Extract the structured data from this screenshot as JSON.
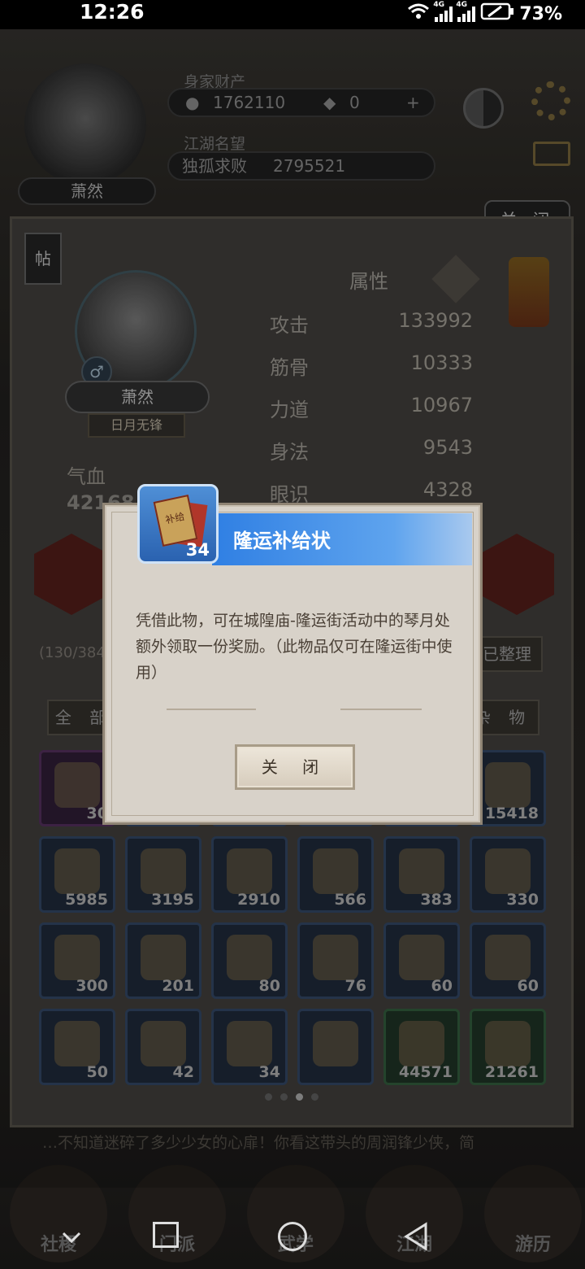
{
  "status": {
    "time": "12:26",
    "battery": "73%",
    "net1": "4G",
    "net2": "4G"
  },
  "header": {
    "wealth_label": "身家财产",
    "coins": "1762110",
    "gems": "0",
    "add": "+",
    "fame_label": "江湖名望",
    "fame_title": "独孤求败",
    "fame_value": "2795521",
    "player_name": "萧然"
  },
  "panel": {
    "close_label": "关 闭",
    "post_label": "帖",
    "attr_title": "属性",
    "char_name": "萧然",
    "char_title": "日月无锋",
    "attributes": [
      {
        "name": "攻击",
        "value": "133992"
      },
      {
        "name": "筋骨",
        "value": "10333"
      },
      {
        "name": "力道",
        "value": "10967"
      },
      {
        "name": "身法",
        "value": "9543"
      },
      {
        "name": "眼识",
        "value": "4328"
      }
    ],
    "qixue_label": "气血",
    "qixue_value": "42168",
    "capacity": "(130/384",
    "sort_label": "已整理",
    "tab_all": "全 部",
    "tab_misc": "杂 物"
  },
  "items": [
    {
      "count": "30",
      "tone": "purple"
    },
    {
      "count": "",
      "tone": "blue"
    },
    {
      "count": "",
      "tone": "blue"
    },
    {
      "count": "",
      "tone": "blue"
    },
    {
      "count": "",
      "tone": "blue"
    },
    {
      "count": "15418",
      "tone": "blue"
    },
    {
      "count": "5985",
      "tone": "blue"
    },
    {
      "count": "3195",
      "tone": "blue"
    },
    {
      "count": "2910",
      "tone": "blue"
    },
    {
      "count": "566",
      "tone": "blue"
    },
    {
      "count": "383",
      "tone": "blue"
    },
    {
      "count": "330",
      "tone": "blue"
    },
    {
      "count": "300",
      "tone": "blue"
    },
    {
      "count": "201",
      "tone": "blue"
    },
    {
      "count": "80",
      "tone": "blue"
    },
    {
      "count": "76",
      "tone": "blue"
    },
    {
      "count": "60",
      "tone": "blue"
    },
    {
      "count": "60",
      "tone": "blue"
    },
    {
      "count": "50",
      "tone": "blue"
    },
    {
      "count": "42",
      "tone": "blue"
    },
    {
      "count": "34",
      "tone": "blue"
    },
    {
      "count": "",
      "tone": "blue"
    },
    {
      "count": "44571",
      "tone": "green"
    },
    {
      "count": "21261",
      "tone": "green"
    }
  ],
  "story": {
    "line1": "…不知道迷碎了多少少女的心扉！你看这带头的周润锋少侠，简"
  },
  "popup": {
    "title": "隆运补给状",
    "count": "34",
    "card_text": "补给",
    "description": "凭借此物，可在城隍庙-隆运街活动中的琴月处额外领取一份奖励。（此物品仅可在隆运街中使用）",
    "close_label": "关 闭"
  },
  "bottom_menu": [
    "社稷",
    "门派",
    "武学",
    "江湖",
    "游历"
  ]
}
